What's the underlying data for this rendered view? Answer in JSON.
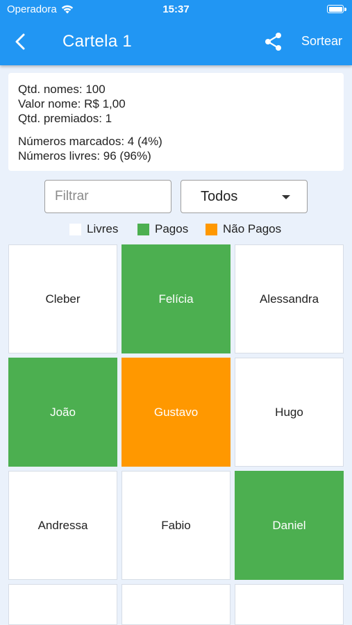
{
  "status_bar": {
    "carrier": "Operadora",
    "time": "15:37"
  },
  "app_bar": {
    "title": "Cartela 1",
    "sortear_label": "Sortear",
    "back_icon": "chevron-left-icon",
    "share_icon": "share-icon"
  },
  "info": {
    "qtd_nomes": "Qtd. nomes: 100",
    "valor_nome": "Valor nome: R$ 1,00",
    "qtd_premiados": "Qtd. premiados: 1",
    "numeros_marcados": "Números marcados: 4 (4%)",
    "numeros_livres": "Números livres: 96 (96%)"
  },
  "filter": {
    "placeholder": "Filtrar",
    "value": ""
  },
  "status_select": {
    "value": "Todos"
  },
  "legend": [
    {
      "label": "Livres",
      "color": "#ffffff"
    },
    {
      "label": "Pagos",
      "color": "#4caf50"
    },
    {
      "label": "Não Pagos",
      "color": "#ff9800"
    }
  ],
  "colors": {
    "primary": "#2196f3",
    "pago": "#4caf50",
    "nao_pago": "#ff9800",
    "livre": "#ffffff",
    "background": "#eaf1fb"
  },
  "names": [
    {
      "name": "Cleber",
      "status": "livre"
    },
    {
      "name": "Felícia",
      "status": "pago"
    },
    {
      "name": "Alessandra",
      "status": "livre"
    },
    {
      "name": "João",
      "status": "pago"
    },
    {
      "name": "Gustavo",
      "status": "naopago"
    },
    {
      "name": "Hugo",
      "status": "livre"
    },
    {
      "name": "Andressa",
      "status": "livre"
    },
    {
      "name": "Fabio",
      "status": "livre"
    },
    {
      "name": "Daniel",
      "status": "pago"
    },
    {
      "name": "",
      "status": "livre"
    },
    {
      "name": "",
      "status": "livre"
    },
    {
      "name": "",
      "status": "livre"
    }
  ]
}
